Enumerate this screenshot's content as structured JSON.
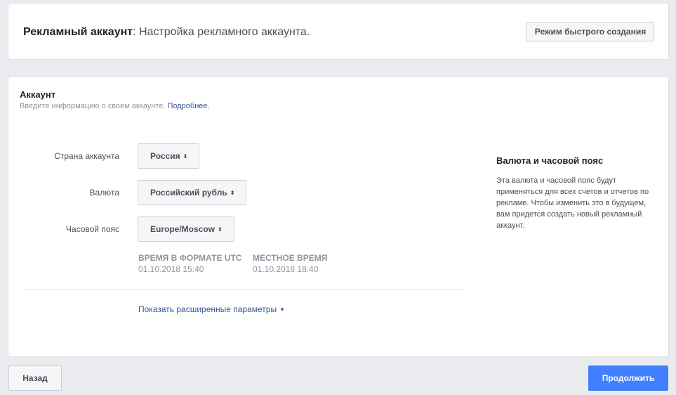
{
  "header": {
    "title_bold": "Рекламный аккаунт",
    "title_rest": ": Настройка рекламного аккаунта.",
    "quick_mode_label": "Режим быстрого создания"
  },
  "account": {
    "title": "Аккаунт",
    "description": "Введите информацию о своем аккаунте.",
    "more_link": "Подробнее.",
    "fields": {
      "country_label": "Страна аккаунта",
      "country_value": "Россия",
      "currency_label": "Валюта",
      "currency_value": "Российский рубль",
      "timezone_label": "Часовой пояс",
      "timezone_value": "Europe/Moscow"
    },
    "times": {
      "utc_heading": "ВРЕМЯ В ФОРМАТЕ UTC",
      "utc_value": "01.10.2018 15:40",
      "local_heading": "МЕСТНОЕ ВРЕМЯ",
      "local_value": "01.10.2018 18:40"
    },
    "advanced_link": "Показать расширенные параметры"
  },
  "side_panel": {
    "title": "Валюта и часовой пояс",
    "text": "Эта валюта и часовой пояс будут применяться для всех счетов и отчетов по рекламе. Чтобы изменить это в будущем, вам придется создать новый рекламный аккаунт."
  },
  "footer": {
    "back_label": "Назад",
    "continue_label": "Продолжить"
  },
  "colors": {
    "background": "#e9ebee",
    "link": "#365899",
    "primary_button": "#4080ff"
  },
  "icons": {
    "select_arrows": "up-down-arrows-icon",
    "advanced_caret": "caret-down-icon"
  }
}
